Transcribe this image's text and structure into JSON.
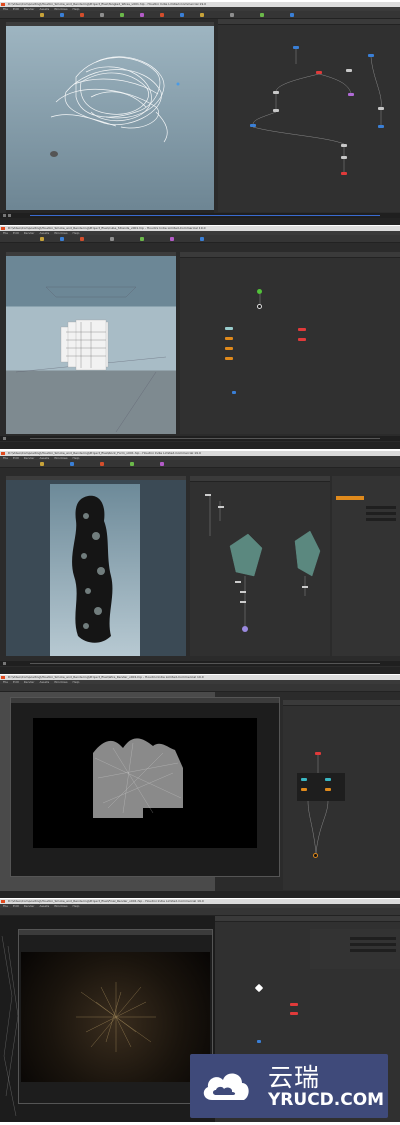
{
  "panels": [
    {
      "window_title": "D:\\Video\\Compositing\\Houdini_Smoke_and_Rendering\\Project_files\\Tangled_Wires_v001.hip - Houdini Indie Limited-Commercial 19.0"
    },
    {
      "window_title": "D:\\Video\\Compositing\\Houdini_Smoke_and_Rendering\\Project_files\\Cube_Strands_v001.hip - Houdini Indie Limited-Commercial 19.0"
    },
    {
      "window_title": "D:\\Video\\Compositing\\Houdini_Smoke_and_Rendering\\Project_files\\Rock_Form_v001.hip - Houdini Indie Limited-Commercial 19.0"
    },
    {
      "window_title": "D:\\Video\\Compositing\\Houdini_Smoke_and_Rendering\\Project_files\\Wire_Render_v001.hip - Houdini Indie Limited-Commercial 19.0"
    },
    {
      "window_title": "D:\\Video\\Compositing\\Houdini_Smoke_and_Rendering\\Project_files\\Final_Render_v001.hip - Houdini Indie Limited-Commercial 19.0"
    }
  ],
  "menu": [
    "File",
    "Edit",
    "Render",
    "Assets",
    "Windows",
    "Help"
  ],
  "watermark": {
    "brand_cn": "云瑞",
    "brand_en": "YRUCD.COM"
  },
  "colors": {
    "viewport_sky_top": "#a9c0cc",
    "viewport_sky_bottom": "#6f8796",
    "network_bg": "#303030",
    "node_red": "#e03a3a",
    "node_blue": "#3a7fd6",
    "node_green": "#52c23a",
    "node_orange": "#e08a1c",
    "node_cyan": "#3ab6c2",
    "watermark_bg": "#3f4a7a"
  }
}
